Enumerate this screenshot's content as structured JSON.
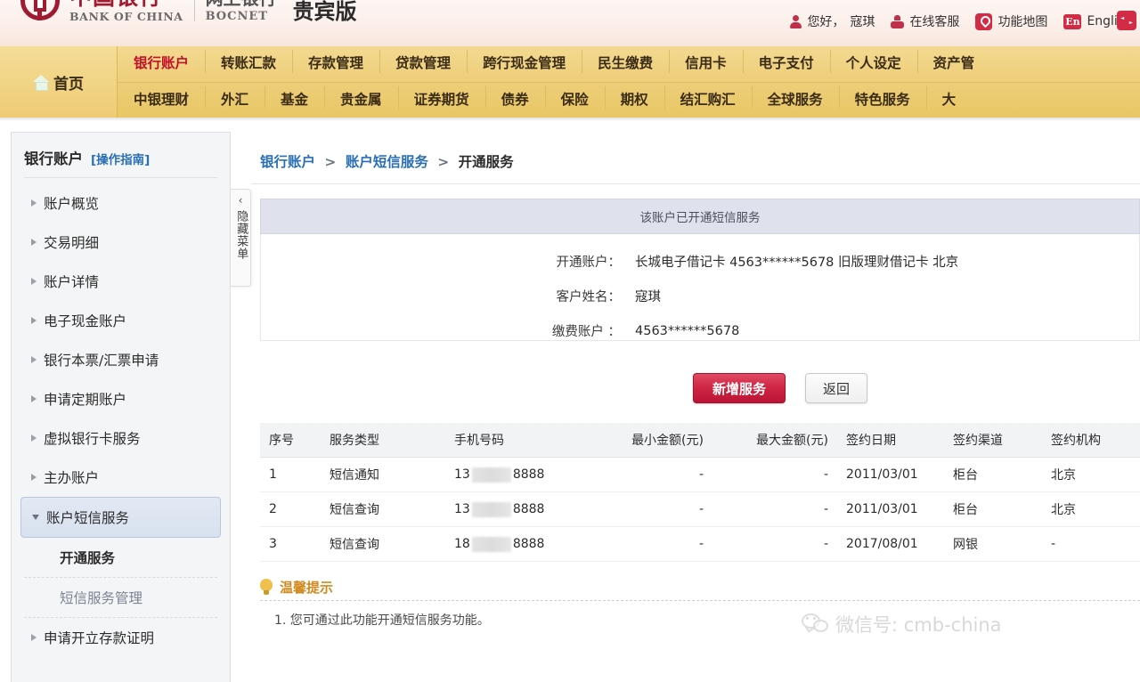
{
  "header": {
    "brand_cn": "中国银行",
    "brand_en": "BANK OF CHINA",
    "brand2_cn": "网上银行",
    "brand2_en": "BOCNET",
    "edition": "贵宾版",
    "greeting": "您好，",
    "user_name": "寇琪",
    "online_service": "在线客服",
    "function_map": "功能地图",
    "language": "English",
    "lang_badge": "En",
    "accent_color": "#d12b45"
  },
  "nav": {
    "home": "首页",
    "row1": [
      {
        "label": "银行账户",
        "active": true
      },
      {
        "label": "转账汇款",
        "active": false
      },
      {
        "label": "存款管理",
        "active": false
      },
      {
        "label": "贷款管理",
        "active": false
      },
      {
        "label": "跨行现金管理",
        "active": false
      },
      {
        "label": "民生缴费",
        "active": false
      },
      {
        "label": "信用卡",
        "active": false
      },
      {
        "label": "电子支付",
        "active": false
      },
      {
        "label": "个人设定",
        "active": false
      },
      {
        "label": "资产管",
        "active": false
      }
    ],
    "row2": [
      {
        "label": "中银理财"
      },
      {
        "label": "外汇"
      },
      {
        "label": "基金"
      },
      {
        "label": "贵金属"
      },
      {
        "label": "证券期货"
      },
      {
        "label": "债券"
      },
      {
        "label": "保险"
      },
      {
        "label": "期权"
      },
      {
        "label": "结汇购汇"
      },
      {
        "label": "全球服务"
      },
      {
        "label": "特色服务"
      },
      {
        "label": "大"
      }
    ]
  },
  "sidebar": {
    "title": "银行账户",
    "guide": "[操作指南]",
    "items": [
      {
        "label": "账户概览",
        "type": "collapsed"
      },
      {
        "label": "交易明细",
        "type": "collapsed"
      },
      {
        "label": "账户详情",
        "type": "collapsed"
      },
      {
        "label": "电子现金账户",
        "type": "collapsed"
      },
      {
        "label": "银行本票/汇票申请",
        "type": "collapsed"
      },
      {
        "label": "申请定期账户",
        "type": "collapsed"
      },
      {
        "label": "虚拟银行卡服务",
        "type": "collapsed"
      },
      {
        "label": "主办账户",
        "type": "collapsed"
      },
      {
        "label": "账户短信服务",
        "type": "expanded-active"
      }
    ],
    "sub_items": [
      {
        "label": "开通服务",
        "current": true
      },
      {
        "label": "短信服务管理",
        "current": false
      }
    ],
    "items_after": [
      {
        "label": "申请开立存款证明",
        "type": "collapsed"
      }
    ],
    "hide_menu": "隐藏菜单",
    "hide_menu_chevron": "‹"
  },
  "main": {
    "breadcrumb": {
      "item1": "银行账户",
      "item2": "账户短信服务",
      "item3": "开通服务",
      "separator": ">"
    },
    "notice": "该账户已开通短信服务",
    "info": [
      {
        "label": "开通账户：",
        "value": "长城电子借记卡 4563******5678 旧版理财借记卡 北京"
      },
      {
        "label": "客户姓名：",
        "value": "寇琪"
      },
      {
        "label": "缴费账户 ：",
        "value": "4563******5678"
      }
    ],
    "buttons": {
      "primary": "新增服务",
      "secondary": "返回"
    },
    "table": {
      "columns": [
        "序号",
        "服务类型",
        "手机号码",
        "最小金额(元)",
        "最大金额(元)",
        "签约日期",
        "签约渠道",
        "签约机构"
      ],
      "rows": [
        {
          "seq": "1",
          "service_type": "短信通知",
          "phone_prefix": "13",
          "phone_suffix": "8888",
          "min_amount": "-",
          "max_amount": "-",
          "sign_date": "2011/03/01",
          "channel": "柜台",
          "institution": "北京"
        },
        {
          "seq": "2",
          "service_type": "短信查询",
          "phone_prefix": "13",
          "phone_suffix": "8888",
          "min_amount": "-",
          "max_amount": "-",
          "sign_date": "2011/03/01",
          "channel": "柜台",
          "institution": "北京"
        },
        {
          "seq": "3",
          "service_type": "短信查询",
          "phone_prefix": "18",
          "phone_suffix": "8888",
          "min_amount": "-",
          "max_amount": "-",
          "sign_date": "2017/08/01",
          "channel": "网银",
          "institution": "-"
        }
      ]
    },
    "tips": {
      "title": "温馨提示",
      "item1": "1. 您可通过此功能开通短信服务功能。"
    }
  },
  "watermark": {
    "text": "微信号: cmb-china"
  }
}
